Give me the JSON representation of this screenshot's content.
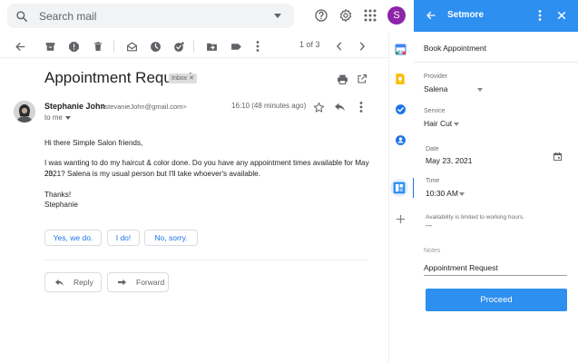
{
  "search": {
    "placeholder": "Search mail"
  },
  "header": {
    "help_icon": "help-circle-icon",
    "settings_icon": "gear-icon",
    "apps_icon": "apps-grid-icon",
    "avatar_initial": "S",
    "avatar_color": "#8e24aa"
  },
  "toolbar": {
    "pager_text": "1 of 3"
  },
  "email": {
    "subject": "Appointment Request",
    "label_chip": "Inbox",
    "sender_name": "Stephanie John",
    "sender_email": "<stevanieJohn@gmail.com>",
    "to": "to me",
    "time": "16:10 (48 minutes ago)",
    "body": {
      "greeting": "Hi there Simple Salon friends,",
      "para1_line1": "I was wanting to do my haircut & color done. Do you have any appointment times available for May 23,",
      "para1_line2": "2021? Salena is my usual person but I'll take whoever's available.",
      "thanks": "Thanks!",
      "signature": "Stephanie"
    },
    "smart_replies": [
      "Yes, we do.",
      "I do!",
      "No, sorry."
    ],
    "reply_label": "Reply",
    "forward_label": "Forward"
  },
  "panel": {
    "title": "Setmore",
    "accent": "#2d8ff0",
    "section_title": "Book Appointment",
    "provider": {
      "label": "Provider",
      "value": "Salena"
    },
    "service": {
      "label": "Service",
      "value": "Hair Cut"
    },
    "date": {
      "label": "Date",
      "value": "May 23, 2021"
    },
    "time": {
      "label": "Time",
      "value": "10:30 AM"
    },
    "availability_note": "Availability is limited to working hours.",
    "availability_value": "---",
    "notes": {
      "label": "Notes",
      "value": "Appointment Request"
    },
    "proceed_label": "Proceed"
  }
}
